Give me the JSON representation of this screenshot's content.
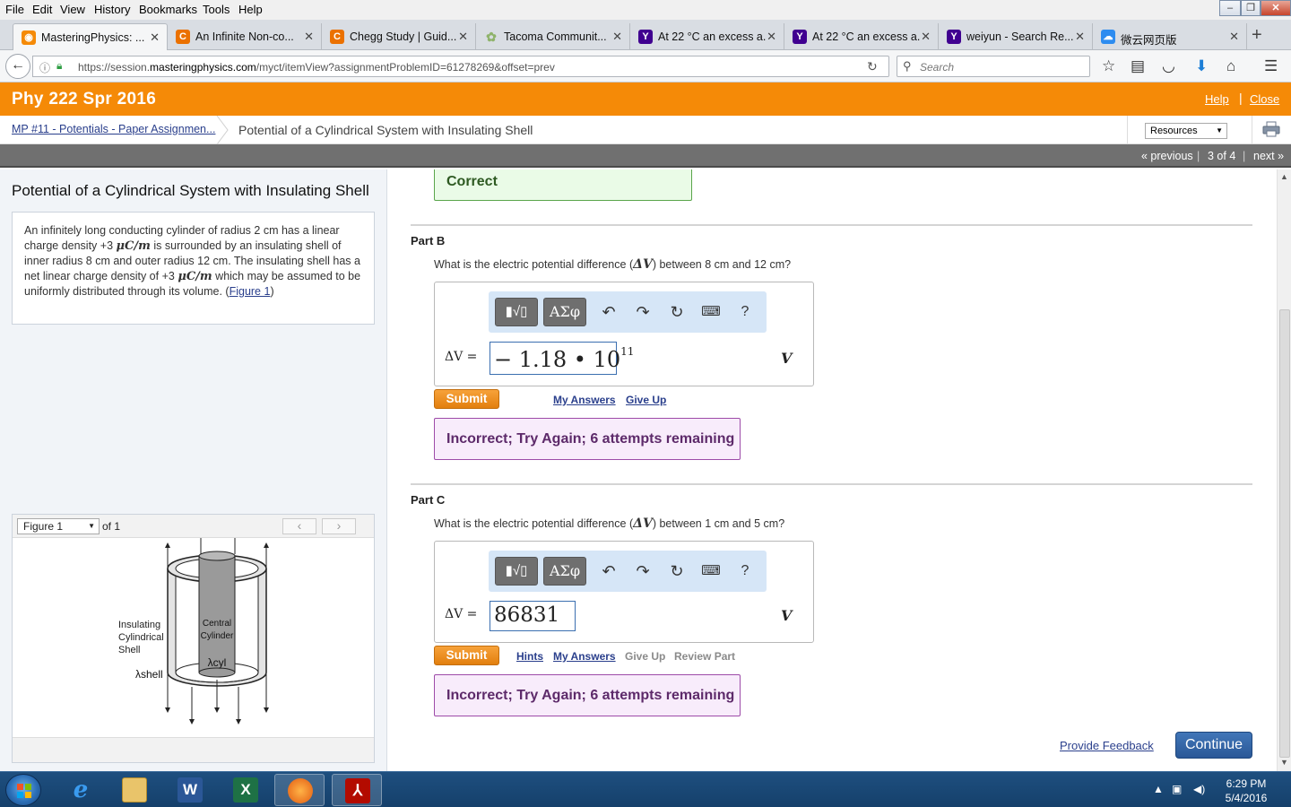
{
  "menu": [
    "File",
    "Edit",
    "View",
    "History",
    "Bookmarks",
    "Tools",
    "Help"
  ],
  "tabs": [
    {
      "label": "MasteringPhysics: ...",
      "icon": "mastering-icon",
      "color": "#f58a07"
    },
    {
      "label": "An Infinite Non-co...",
      "icon": "chegg-icon",
      "color": "#eb7100"
    },
    {
      "label": "Chegg Study | Guid...",
      "icon": "chegg-icon",
      "color": "#eb7100"
    },
    {
      "label": "Tacoma Communit...",
      "icon": "tacoma-icon",
      "color": "#8fb36b"
    },
    {
      "label": "At 22 °C an excess a...",
      "icon": "yahoo-icon",
      "color": "#400090"
    },
    {
      "label": "At 22 °C an excess a...",
      "icon": "yahoo-icon",
      "color": "#400090"
    },
    {
      "label": "weiyun - Search Re...",
      "icon": "yahoo-icon",
      "color": "#400090"
    },
    {
      "label": "微云网页版",
      "icon": "weiyun-icon",
      "color": "#2d8cf0"
    }
  ],
  "url": {
    "prefix": "https://session.",
    "domain": "masteringphysics.com",
    "path": "/myct/itemView?assignmentProblemID=61278269&offset=prev"
  },
  "search_placeholder": "Search",
  "header": {
    "course": "Phy 222 Spr 2016",
    "help": "Help",
    "close": "Close"
  },
  "breadcrumb": {
    "parent": "MP #11 - Potentials - Paper Assignmen...",
    "current": "Potential of a Cylindrical System with Insulating Shell",
    "resources": "Resources"
  },
  "pager": {
    "previous": "« previous",
    "position": "3 of 4",
    "next": "next »"
  },
  "problem": {
    "title": "Potential of a Cylindrical System with Insulating Shell",
    "t1": "An infinitely long conducting cylinder of radius 2 cm has a linear charge density +3",
    "u1": "μC/m",
    "t2": "is surrounded by an insulating shell of inner radius 8 cm and outer radius 12 cm. The insulating shell has a net linear charge density of +3",
    "u2": "μC/m",
    "t3": "which may be assumed to be uniformly distributed through its volume. (",
    "figure_link": "Figure 1",
    "t4": ")"
  },
  "figure": {
    "selected": "Figure 1",
    "of": "of 1",
    "label_shell_1": "Insulating",
    "label_shell_2": "Cylindrical",
    "label_shell_3": "Shell",
    "label_central_1": "Central",
    "label_central_2": "Cylinder",
    "lambda_cyl": "λcyl",
    "lambda_shell": "λshell"
  },
  "correct_text": "Correct",
  "part_b": {
    "title": "Part B",
    "q_before": "What is the electric potential difference (",
    "q_symbol": "ΔV",
    "q_after": ") between 8 cm and 12 cm?",
    "label": "ΔV =",
    "answer_base": "− 1.18 • 10",
    "answer_exp": "11",
    "unit": "V",
    "submit": "Submit",
    "links": [
      "My Answers",
      "Give Up"
    ],
    "feedback": "Incorrect; Try Again; 6 attempts remaining"
  },
  "part_c": {
    "title": "Part C",
    "q_before": "What is the electric potential difference (",
    "q_symbol": "ΔV",
    "q_after": ") between 1 cm and 5 cm?",
    "label": "ΔV =",
    "answer": "86831",
    "unit": "V",
    "submit": "Submit",
    "links": [
      "Hints",
      "My Answers"
    ],
    "disabled_links": [
      "Give Up",
      "Review Part"
    ],
    "feedback": "Incorrect; Try Again; 6 attempts remaining"
  },
  "toolbar": {
    "template": "▮√▯",
    "greek": "ΑΣφ",
    "help": "?"
  },
  "footer": {
    "provide_feedback": "Provide Feedback",
    "continue": "Continue"
  },
  "taskbar": {
    "time": "6:29 PM",
    "date": "5/4/2016"
  },
  "colors": {
    "brand_orange": "#f58a07",
    "link_blue": "#2a3f8c",
    "correct_green": "#5aa54b",
    "incorrect_purple": "#9d4ba8",
    "continue_blue": "#2a5897"
  }
}
